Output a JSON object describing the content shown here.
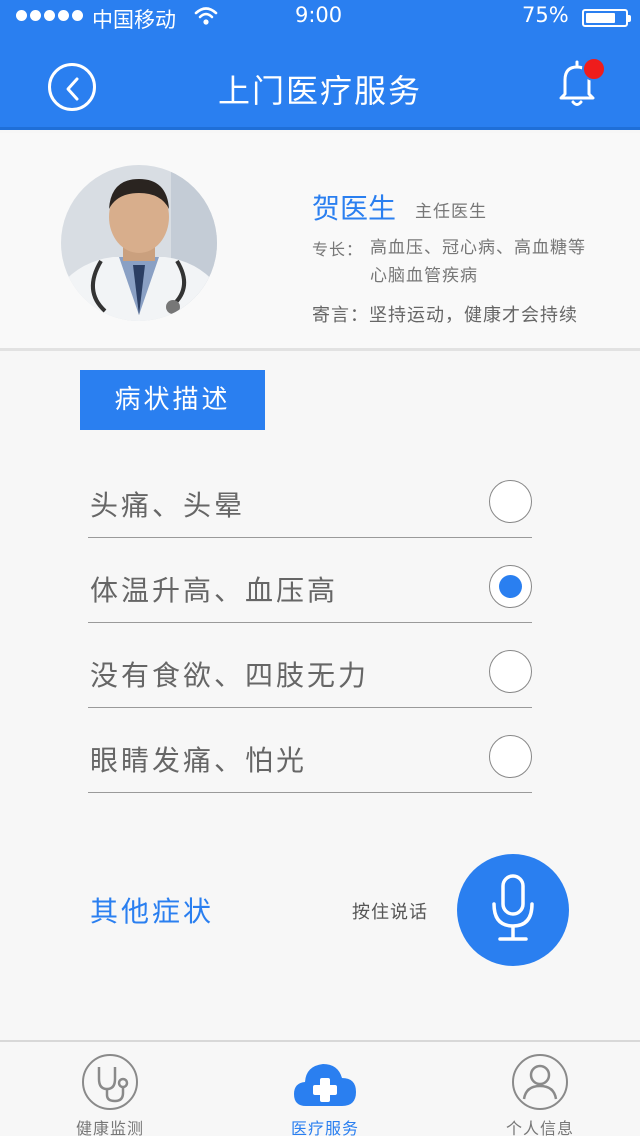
{
  "status_bar": {
    "carrier": "中国移动",
    "time": "9:00",
    "battery": "75%",
    "battery_level": 0.75,
    "signal_icon": "signal-dots-icon",
    "wifi_icon": "wifi-icon"
  },
  "header": {
    "title": "上门医疗服务",
    "back_icon": "chevron-left-icon",
    "notification_icon": "bell-icon",
    "has_unread": true
  },
  "doctor": {
    "name": "贺医生",
    "title": "主任医生",
    "specialty_label": "专长：",
    "specialty": "高血压、冠心病、高血糖等心脑血管疾病",
    "motto": "寄言：坚持运动，健康才会持续"
  },
  "symptoms": {
    "section_label": "病状描述",
    "options": [
      {
        "label": "头痛、头晕",
        "checked": false
      },
      {
        "label": "体温升高、血压高",
        "checked": true
      },
      {
        "label": "没有食欲、四肢无力",
        "checked": false
      },
      {
        "label": "眼睛发痛、怕光",
        "checked": false
      }
    ]
  },
  "other": {
    "label": "其他症状",
    "voice_hint": "按住说话",
    "mic_icon": "microphone-icon"
  },
  "tabbar": {
    "tabs": [
      {
        "label": "健康监测",
        "icon": "stethoscope-icon",
        "active": false
      },
      {
        "label": "医疗服务",
        "icon": "medical-cloud-icon",
        "active": true
      },
      {
        "label": "个人信息",
        "icon": "person-icon",
        "active": false
      }
    ]
  },
  "colors": {
    "primary": "#2a7ff0",
    "badge": "#ef1c1c"
  }
}
